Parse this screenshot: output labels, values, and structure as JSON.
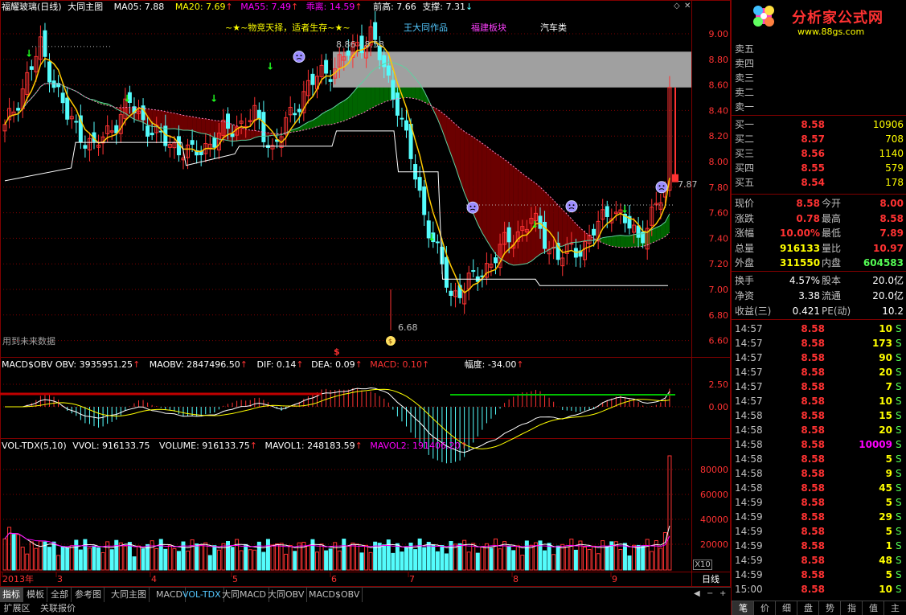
{
  "main_header": {
    "stock": "福耀玻璃(日线)",
    "indicator": "大同主图",
    "ma05": "MA05: 7.88",
    "ma20": "MA20: 7.69",
    "ma55": "MA55: 7.49",
    "guai": "乖离: 14.59",
    "prev_high": "前高: 7.66",
    "support": "支撑: 7.31"
  },
  "banner": {
    "slogan": "~★~物竞天择，适者生存~★~",
    "author": "王大同作品",
    "sector": "福建板块",
    "industry": "汽车类"
  },
  "annotations": {
    "range_label": "8.86 - 8.58",
    "low_label": "6.68",
    "future_data": "用到未来数据",
    "last_price_label": "7.87",
    "s_mark": "$"
  },
  "price_axis": [
    "9.00",
    "8.80",
    "8.60",
    "8.40",
    "8.20",
    "8.00",
    "7.80",
    "7.60",
    "7.40",
    "7.20",
    "7.00",
    "6.80",
    "6.60"
  ],
  "macd_header": {
    "name": "MACD$OBV",
    "obv": "OBV: 3935951.25",
    "maobv": "MAOBV: 2847496.50",
    "dif": "DIF: 0.14",
    "dea": "DEA: 0.09",
    "macd": "MACD: 0.10",
    "fudu": "幅度: -34.00"
  },
  "macd_axis": [
    "2.50",
    "0.00"
  ],
  "vol_header": {
    "name": "VOL-TDX(5,10)",
    "vvol": "VVOL: 916133.75",
    "volume": "VOLUME: 916133.75",
    "mavol1": "MAVOL1: 248183.59",
    "mavol2": "MAVOL2: 191406.20"
  },
  "vol_axis": [
    "80000",
    "60000",
    "40000",
    "20000"
  ],
  "vol_unit": "X10",
  "time_axis": {
    "labels": [
      "2013年",
      "3",
      "4",
      "5",
      "6",
      "7",
      "8",
      "9"
    ],
    "period": "日线"
  },
  "indicator_tabs": [
    "指标",
    "模板",
    "全部",
    "参考图",
    "大同主图",
    "MACD",
    "VOL-TDX",
    "大同MACD",
    "大同OBV",
    "MACD$OBV"
  ],
  "bottom_tabs": [
    "扩展区",
    "关联报价"
  ],
  "logo": {
    "text": "分析家公式网",
    "url": "www.88gs.com"
  },
  "order_book": {
    "sell": [
      {
        "label": "卖五",
        "price": "",
        "vol": ""
      },
      {
        "label": "卖四",
        "price": "",
        "vol": ""
      },
      {
        "label": "卖三",
        "price": "",
        "vol": ""
      },
      {
        "label": "卖二",
        "price": "",
        "vol": ""
      },
      {
        "label": "卖一",
        "price": "",
        "vol": ""
      }
    ],
    "buy": [
      {
        "label": "买一",
        "price": "8.58",
        "vol": "10906"
      },
      {
        "label": "买二",
        "price": "8.57",
        "vol": "708"
      },
      {
        "label": "买三",
        "price": "8.56",
        "vol": "1140"
      },
      {
        "label": "买四",
        "price": "8.55",
        "vol": "579"
      },
      {
        "label": "买五",
        "price": "8.54",
        "vol": "178"
      }
    ]
  },
  "quote": [
    {
      "l1": "现价",
      "v1": "8.58",
      "l2": "今开",
      "v2": "8.00"
    },
    {
      "l1": "涨跌",
      "v1": "0.78",
      "l2": "最高",
      "v2": "8.58"
    },
    {
      "l1": "涨幅",
      "v1": "10.00%",
      "l2": "最低",
      "v2": "7.89"
    },
    {
      "l1": "总量",
      "v1": "916133",
      "l2": "量比",
      "v2": "10.97"
    },
    {
      "l1": "外盘",
      "v1": "311550",
      "l2": "内盘",
      "v2": "604583"
    }
  ],
  "stats": [
    {
      "l1": "换手",
      "v1": "4.57%",
      "l2": "股本",
      "v2": "20.0亿"
    },
    {
      "l1": "净资",
      "v1": "3.38",
      "l2": "流通",
      "v2": "20.0亿"
    },
    {
      "l1": "收益(三)",
      "v1": "0.421",
      "l2": "PE(动)",
      "v2": "10.2"
    }
  ],
  "ticks": [
    {
      "t": "14:57",
      "p": "8.58",
      "v": "10",
      "d": "S"
    },
    {
      "t": "14:57",
      "p": "8.58",
      "v": "173",
      "d": "S"
    },
    {
      "t": "14:57",
      "p": "8.58",
      "v": "90",
      "d": "S"
    },
    {
      "t": "14:57",
      "p": "8.58",
      "v": "20",
      "d": "S"
    },
    {
      "t": "14:57",
      "p": "8.58",
      "v": "7",
      "d": "S"
    },
    {
      "t": "14:57",
      "p": "8.58",
      "v": "10",
      "d": "S"
    },
    {
      "t": "14:58",
      "p": "8.58",
      "v": "15",
      "d": "S"
    },
    {
      "t": "14:58",
      "p": "8.58",
      "v": "20",
      "d": "S"
    },
    {
      "t": "14:58",
      "p": "8.58",
      "v": "10009",
      "d": "S"
    },
    {
      "t": "14:58",
      "p": "8.58",
      "v": "5",
      "d": "S"
    },
    {
      "t": "14:58",
      "p": "8.58",
      "v": "9",
      "d": "S"
    },
    {
      "t": "14:58",
      "p": "8.58",
      "v": "45",
      "d": "S"
    },
    {
      "t": "14:59",
      "p": "8.58",
      "v": "5",
      "d": "S"
    },
    {
      "t": "14:59",
      "p": "8.58",
      "v": "29",
      "d": "S"
    },
    {
      "t": "14:59",
      "p": "8.58",
      "v": "5",
      "d": "S"
    },
    {
      "t": "14:59",
      "p": "8.58",
      "v": "1",
      "d": "S"
    },
    {
      "t": "14:59",
      "p": "8.58",
      "v": "48",
      "d": "S"
    },
    {
      "t": "14:59",
      "p": "8.58",
      "v": "5",
      "d": "S"
    },
    {
      "t": "15:00",
      "p": "8.58",
      "v": "10",
      "d": "S"
    }
  ],
  "right_tabs": [
    "笔",
    "价",
    "细",
    "盘",
    "势",
    "指",
    "值",
    "主"
  ],
  "colors": {
    "up": "#ff3232",
    "down": "#54fcfc",
    "ma05": "#ffffff",
    "ma20": "#ffff00",
    "ma55": "#ff00ff",
    "grid": "#800000",
    "green_band": "#006400",
    "red_band": "#6b0000",
    "yellow_line": "#ffc800"
  }
}
